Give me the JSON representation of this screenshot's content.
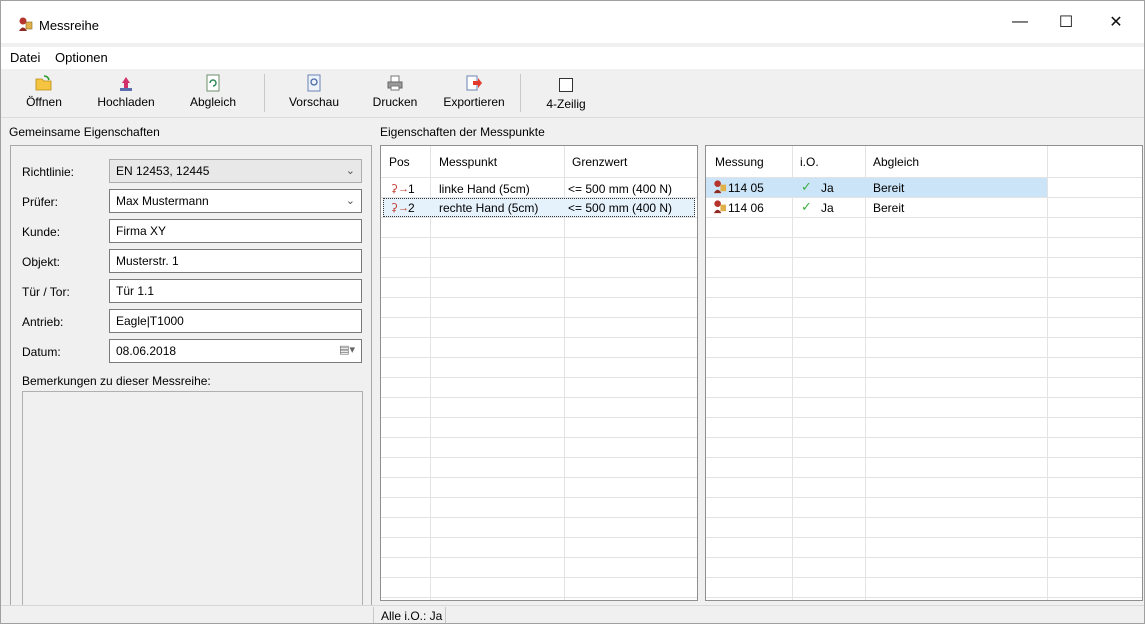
{
  "window": {
    "title": "Messreihe",
    "min": "—",
    "max": "☐",
    "close": "✕"
  },
  "menu": [
    "Datei",
    "Optionen"
  ],
  "toolbar": {
    "open": "Öffnen",
    "upload": "Hochladen",
    "sync": "Abgleich",
    "preview": "Vorschau",
    "print": "Drucken",
    "export": "Exportieren",
    "four_line": "4-Zeilig"
  },
  "common": {
    "header": "Gemeinsame Eigenschaften",
    "fields": [
      {
        "label": "Richtlinie:",
        "value": "EN 12453, 12445"
      },
      {
        "label": "Prüfer:",
        "value": "Max Mustermann"
      },
      {
        "label": "Kunde:",
        "value": "Firma XY"
      },
      {
        "label": "Objekt:",
        "value": "Musterstr. 1"
      },
      {
        "label": "Tür / Tor:",
        "value": "Tür 1.1"
      },
      {
        "label": "Antrieb:",
        "value": "Eagle|T1000"
      },
      {
        "label": "Datum:",
        "value": "08.06.2018"
      }
    ],
    "remarks_label": "Bemerkungen zu dieser Messreihe:",
    "remarks": ""
  },
  "points": {
    "header": "Eigenschaften der Messpunkte",
    "columns": [
      "Pos",
      "Messpunkt",
      "Grenzwert"
    ],
    "rows": [
      {
        "pos": "1",
        "point": "linke Hand (5cm)",
        "limit": "<= 500 mm (400 N)"
      },
      {
        "pos": "2",
        "point": "rechte Hand (5cm)",
        "limit": "<= 500 mm (400 N)"
      }
    ]
  },
  "measurements": {
    "columns": [
      "Messung",
      "i.O.",
      "Abgleich"
    ],
    "rows": [
      {
        "id": "114 05",
        "ok": "Ja",
        "sync": "Bereit"
      },
      {
        "id": "114 06",
        "ok": "Ja",
        "sync": "Bereit"
      }
    ]
  },
  "status": {
    "text": "Alle i.O.: Ja"
  },
  "colors": {
    "selection": "#cce4f7",
    "check": "#3cb043",
    "accent_red": "#c0392b"
  }
}
